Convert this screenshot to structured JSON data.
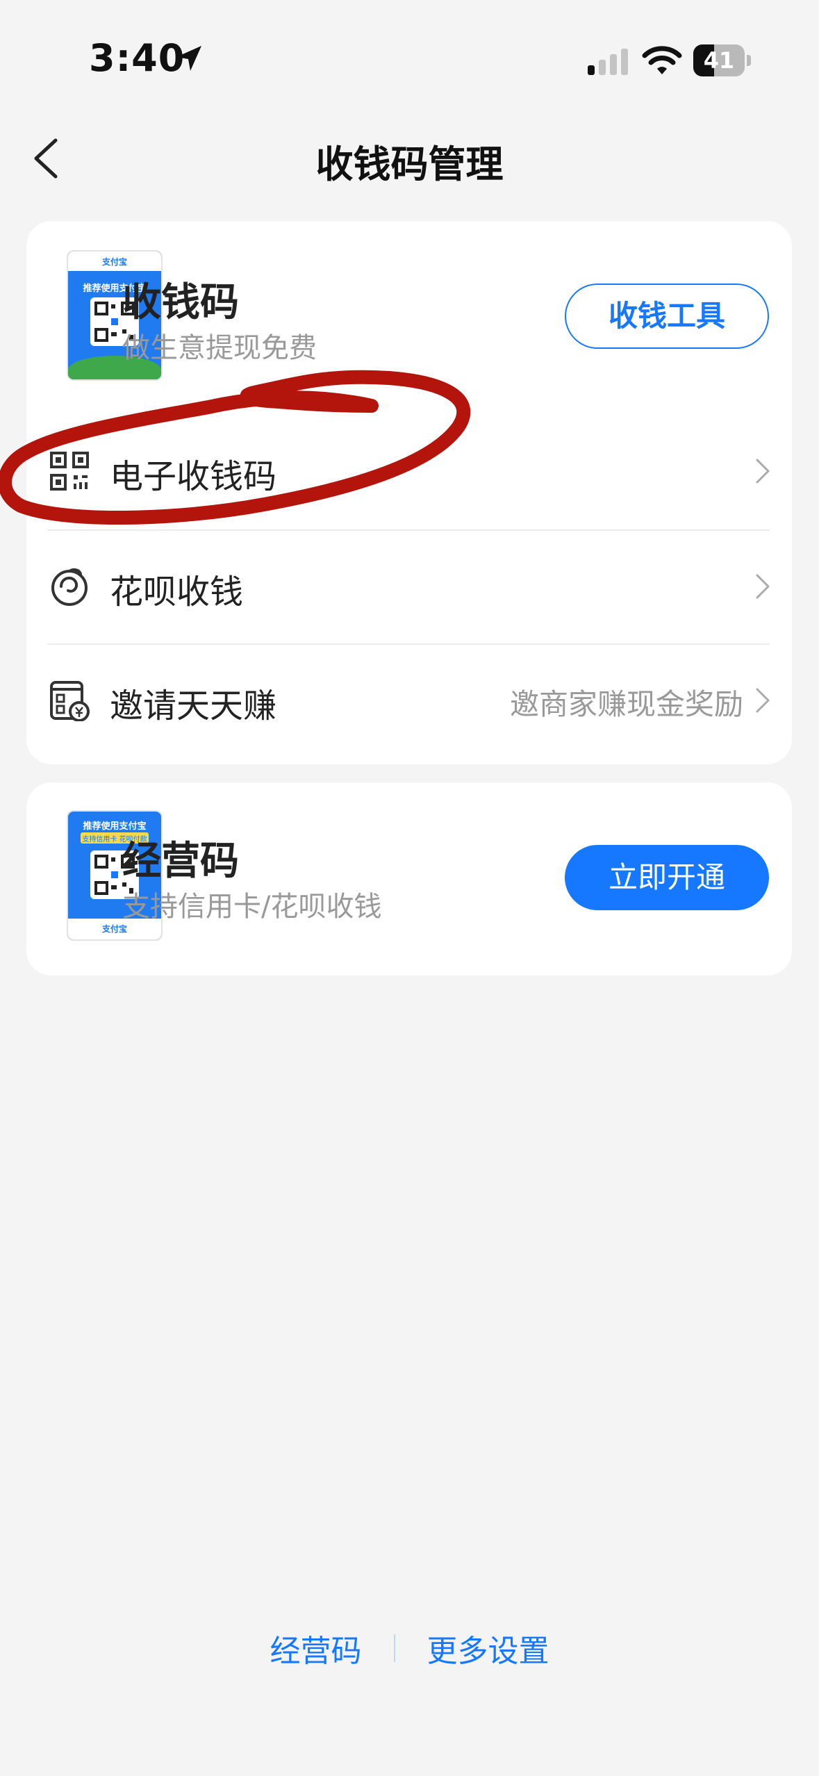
{
  "status_bar": {
    "time": "3:40",
    "battery": "41",
    "icons": [
      "location-arrow-icon",
      "signal-icon",
      "wifi-icon",
      "battery-icon"
    ]
  },
  "header": {
    "title": "收钱码管理",
    "back_icon": "chevron-left-icon"
  },
  "cards": {
    "qr_code": {
      "title": "收钱码",
      "subtitle": "做生意提现免费",
      "button": "收钱工具",
      "thumb_brand": "支付宝",
      "thumb_slogan": "推荐使用支付宝",
      "rows": [
        {
          "icon": "qr-code-icon",
          "label": "电子收钱码",
          "note": ""
        },
        {
          "icon": "huabei-icon",
          "label": "花呗收钱",
          "note": ""
        },
        {
          "icon": "invite-earn-icon",
          "label": "邀请天天赚",
          "note": "邀商家赚现金奖励"
        }
      ]
    },
    "business_code": {
      "title": "经营码",
      "subtitle": "支持信用卡/花呗收钱",
      "button": "立即开通",
      "thumb_brand": "支付宝",
      "thumb_slogan": "推荐使用支付宝",
      "thumb_tag": "支持信用卡 花呗付款"
    }
  },
  "footer": {
    "link1": "经营码",
    "link2": "更多设置"
  },
  "colors": {
    "accent": "#1677ff",
    "annotation": "#b3140c",
    "background": "#f4f4f4"
  }
}
